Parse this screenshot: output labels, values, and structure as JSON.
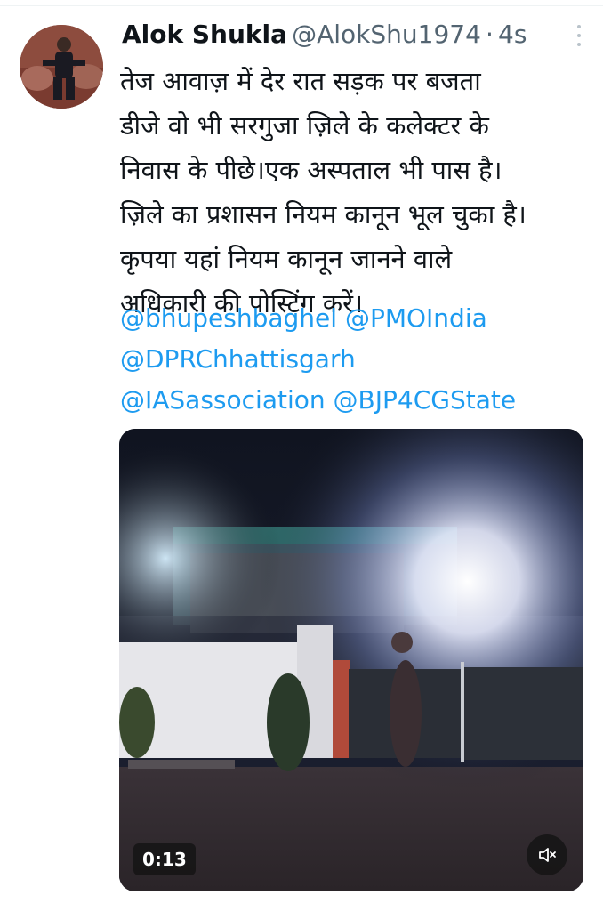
{
  "tweet": {
    "author_name": "Alok Shukla",
    "handle": "@AlokShu1974",
    "separator": "·",
    "time_ago": "4s",
    "text_lines": [
      "तेज आवाज़ में देर रात सड़क पर बजता",
      "डीजे वो भी सरगुजा ज़िले के कलेक्टर के",
      "निवास के पीछे।एक अस्पताल भी पास है।",
      "ज़िले का प्रशासन नियम कानून भूल चुका है।",
      "कृपया यहां नियम कानून जानने वाले",
      "अधिकारी की पोस्टिंग करें।"
    ],
    "mentions": {
      "m1": "@bhupeshbaghel",
      "m2": "@PMOIndia",
      "m3": "@DPRChhattisgarh",
      "m4": "@IASassociation",
      "m5": "@BJP4CGState"
    }
  },
  "video": {
    "duration": "0:13",
    "muted_icon": "speaker-muted-icon"
  },
  "colors": {
    "link": "#1d9bf0",
    "text": "#0f1419",
    "secondary": "#536471"
  }
}
